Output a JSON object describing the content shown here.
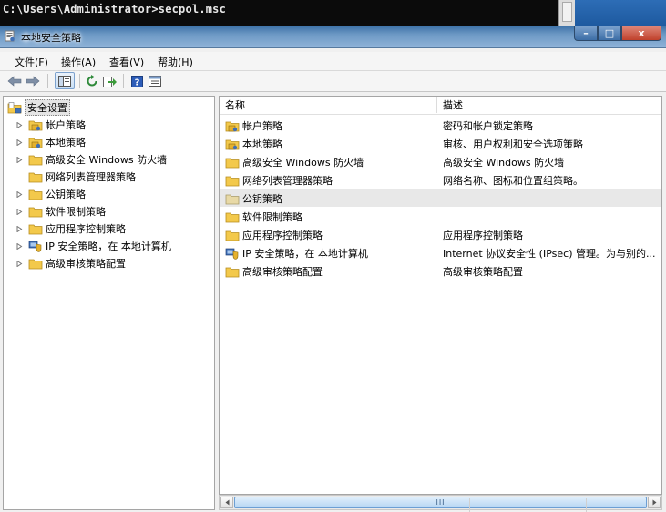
{
  "console": {
    "command_line": "C:\\Users\\Administrator>secpol.msc"
  },
  "window": {
    "title": "本地安全策略",
    "buttons": {
      "minimize": "–",
      "maximize": "□",
      "close": "x"
    }
  },
  "menu": [
    "文件(F)",
    "操作(A)",
    "查看(V)",
    "帮助(H)"
  ],
  "toolbar": {
    "icons": [
      "back-arrow-icon",
      "forward-arrow-icon",
      "show-hide-console-tree-icon",
      "refresh-icon",
      "export-list-icon",
      "help-icon",
      "properties-icon"
    ]
  },
  "tree": {
    "root": "安全设置",
    "items": [
      {
        "label": "帐户策略",
        "icon": "folder-policy"
      },
      {
        "label": "本地策略",
        "icon": "folder-policy"
      },
      {
        "label": "高级安全 Windows 防火墙",
        "icon": "folder"
      },
      {
        "label": "网络列表管理器策略",
        "icon": "folder"
      },
      {
        "label": "公钥策略",
        "icon": "folder"
      },
      {
        "label": "软件限制策略",
        "icon": "folder"
      },
      {
        "label": "应用程序控制策略",
        "icon": "folder"
      },
      {
        "label": "IP 安全策略，在 本地计算机",
        "icon": "ipsec-shield"
      },
      {
        "label": "高级审核策略配置",
        "icon": "folder"
      }
    ]
  },
  "list": {
    "columns": {
      "name": "名称",
      "description": "描述"
    },
    "rows": [
      {
        "name": "帐户策略",
        "description": "密码和帐户锁定策略",
        "icon": "folder-policy"
      },
      {
        "name": "本地策略",
        "description": "审核、用户权利和安全选项策略",
        "icon": "folder-policy"
      },
      {
        "name": "高级安全 Windows 防火墙",
        "description": "高级安全 Windows 防火墙",
        "icon": "folder"
      },
      {
        "name": "网络列表管理器策略",
        "description": "网络名称、图标和位置组策略。",
        "icon": "folder"
      },
      {
        "name": "公钥策略",
        "description": "",
        "icon": "folder",
        "selected": true
      },
      {
        "name": "软件限制策略",
        "description": "",
        "icon": "folder"
      },
      {
        "name": "应用程序控制策略",
        "description": "应用程序控制策略",
        "icon": "folder"
      },
      {
        "name": "IP 安全策略，在 本地计算机",
        "description": "Internet 协议安全性 (IPsec) 管理。为与别的...",
        "icon": "ipsec-shield"
      },
      {
        "name": "高级审核策略配置",
        "description": "高级审核策略配置",
        "icon": "folder"
      }
    ]
  },
  "scrollbar": {
    "thumb_grip": "III"
  },
  "colors": {
    "titlebar": "#6c98c4",
    "folder": "#f3c94b",
    "selection": "#e8e8e8",
    "thumb": "#b7d6f3"
  }
}
